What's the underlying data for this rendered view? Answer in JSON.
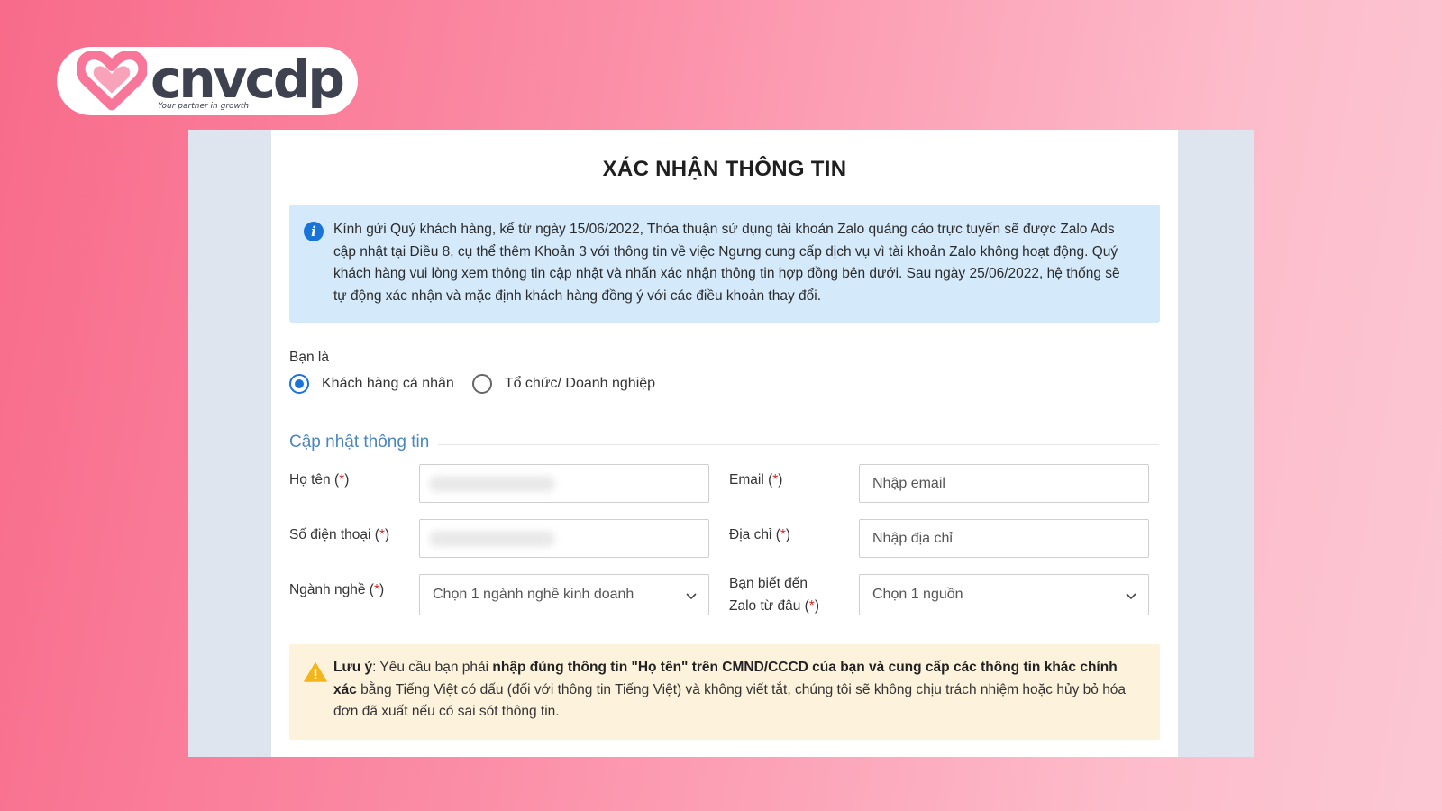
{
  "brand": {
    "name": "cnvcdp",
    "tagline": "Your partner in growth",
    "colors": {
      "heart": "#f7769a",
      "text": "#3d4150"
    }
  },
  "form": {
    "title": "XÁC NHẬN THÔNG TIN",
    "info_notice": "Kính gửi Quý khách hàng, kể từ ngày 15/06/2022, Thỏa thuận sử dụng tài khoản Zalo quảng cáo trực tuyến sẽ được Zalo Ads cập nhật tại Điều 8, cụ thể thêm Khoản 3 với thông tin về việc Ngưng cung cấp dịch vụ vì tài khoản Zalo không hoạt động. Quý khách hàng vui lòng xem thông tin cập nhật và nhấn xác nhận thông tin hợp đồng bên dưới. Sau ngày 25/06/2022, hệ thống sẽ tự động xác nhận và mặc định khách hàng đồng ý với các điều khoản thay đổi.",
    "customer_type": {
      "label": "Bạn là",
      "options": [
        {
          "label": "Khách hàng cá nhân",
          "checked": true
        },
        {
          "label": "Tổ chức/ Doanh nghiệp",
          "checked": false
        }
      ]
    },
    "section_title": "Cập nhật thông tin",
    "required_mark": "*",
    "fields": {
      "full_name": {
        "label": "Họ tên",
        "value": ""
      },
      "email": {
        "label": "Email",
        "placeholder": "Nhập email"
      },
      "phone": {
        "label": "Số điện thoại",
        "value": ""
      },
      "address": {
        "label": "Địa chỉ",
        "placeholder": "Nhập địa chỉ"
      },
      "industry": {
        "label": "Ngành nghề",
        "selected": "Chọn 1 ngành nghề kinh doanh"
      },
      "source": {
        "label_line1": "Bạn biết đến",
        "label_line2": "Zalo từ đâu",
        "selected": "Chọn 1 nguồn"
      }
    },
    "warning": {
      "prefix": "Lưu ý",
      "text_1": ": Yêu cầu bạn phải ",
      "bold_1": "nhập đúng thông tin \"Họ tên\" trên CMND/CCCD của bạn và cung cấp các thông tin khác chính xác",
      "text_2": " bằng Tiếng Việt có dấu (đối với thông tin Tiếng Việt) và không viết tắt, chúng tôi sẽ không chịu trách nhiệm hoặc hủy bỏ hóa đơn đã xuất nếu có sai sót thông tin."
    },
    "colors": {
      "info_bg": "#d4e9fa",
      "warning_bg": "#fdf2dc",
      "accent_blue": "#1a73d9",
      "section_title": "#4a86bf",
      "required": "#e02424"
    }
  }
}
